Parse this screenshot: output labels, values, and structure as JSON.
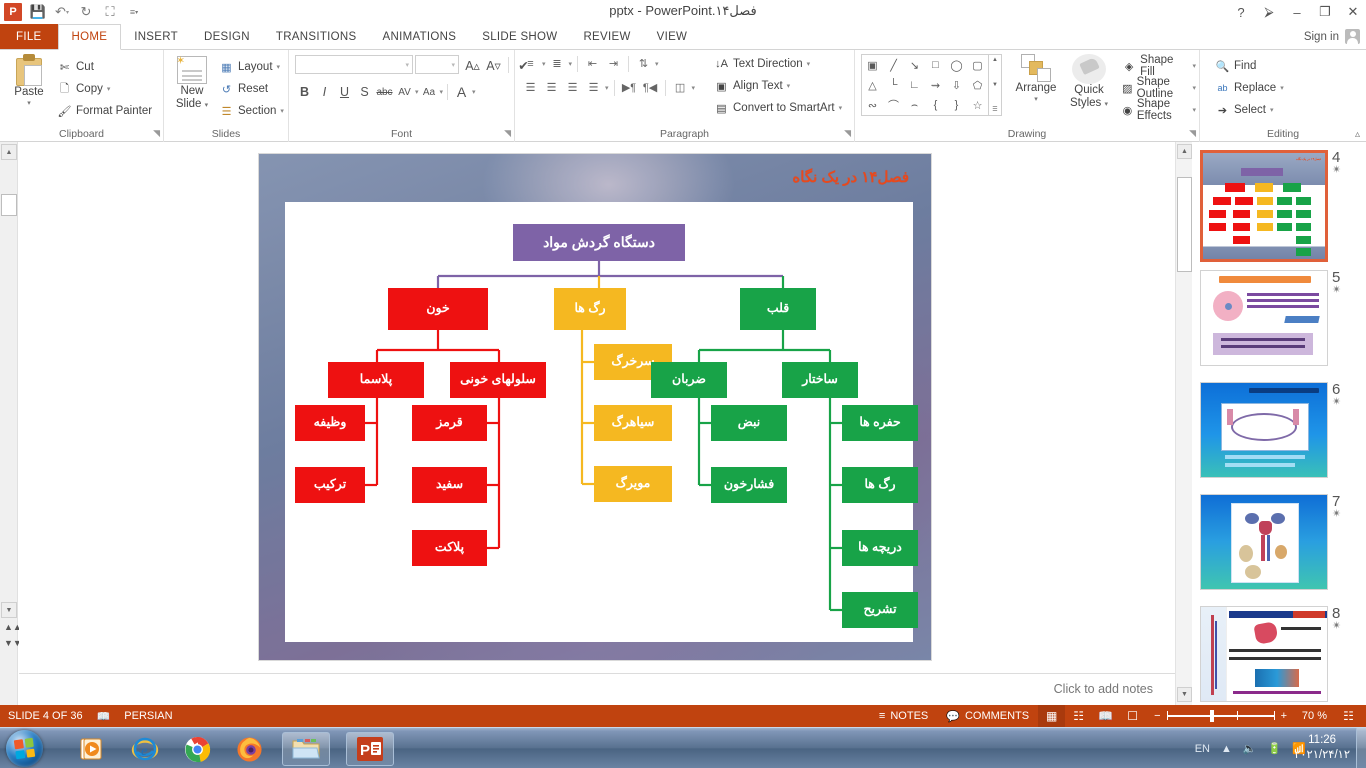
{
  "titlebar": {
    "app_logo": "powerpoint-logo",
    "document_title": "فصل۱۴.pptx - PowerPoint",
    "qat": [
      {
        "name": "save",
        "glyph": "💾"
      },
      {
        "name": "undo",
        "glyph": "↶"
      },
      {
        "name": "redo",
        "glyph": "↻"
      },
      {
        "name": "start-slideshow",
        "glyph": "▣"
      },
      {
        "name": "customize-qat",
        "glyph": "≡"
      }
    ],
    "window_buttons": [
      {
        "name": "help",
        "glyph": "?"
      },
      {
        "name": "ribbon-display-options",
        "glyph": "⬚"
      },
      {
        "name": "minimize",
        "glyph": "–"
      },
      {
        "name": "restore",
        "glyph": "❐"
      },
      {
        "name": "close",
        "glyph": "✕"
      }
    ]
  },
  "tabs": {
    "file": "FILE",
    "items": [
      "HOME",
      "INSERT",
      "DESIGN",
      "TRANSITIONS",
      "ANIMATIONS",
      "SLIDE SHOW",
      "REVIEW",
      "VIEW"
    ],
    "active": "HOME",
    "sign_in": "Sign in"
  },
  "ribbon": {
    "clipboard": {
      "label": "Clipboard",
      "paste": "Paste",
      "cut": "Cut",
      "copy": "Copy",
      "format_painter": "Format Painter"
    },
    "slides": {
      "label": "Slides",
      "new_slide": "New\nSlide",
      "new_slide_line1": "New",
      "new_slide_line2": "Slide",
      "layout": "Layout",
      "reset": "Reset",
      "section": "Section"
    },
    "font": {
      "label": "Font",
      "font_name_value": "",
      "font_size_value": "",
      "buttons": [
        "B",
        "I",
        "U",
        "S",
        "abc",
        "AV",
        "Aa",
        "A"
      ]
    },
    "paragraph": {
      "label": "Paragraph",
      "text_direction": "Text Direction",
      "align_text": "Align Text",
      "convert_to_smartart": "Convert to SmartArt"
    },
    "drawing": {
      "label": "Drawing",
      "arrange": "Arrange",
      "quick_styles_line1": "Quick",
      "quick_styles_line2": "Styles",
      "shape_fill": "Shape Fill",
      "shape_outline": "Shape Outline",
      "shape_effects": "Shape Effects"
    },
    "editing": {
      "label": "Editing",
      "find": "Find",
      "replace": "Replace",
      "select": "Select"
    }
  },
  "slide": {
    "title": "فصل۱۴ در یک نگاه",
    "colors": {
      "root": "#7e63a7",
      "blood": "#ee1111",
      "vessels": "#f5b821",
      "heart": "#18a348",
      "title": "#e8491d"
    },
    "diagram": {
      "root": "دستگاه گردش مواد",
      "branches": [
        {
          "name": "blood",
          "label": "خون",
          "color": "#ee1111",
          "children": [
            {
              "label": "پلاسما",
              "children": [
                {
                  "label": "وظیفه"
                },
                {
                  "label": "ترکیب"
                }
              ]
            },
            {
              "label": "سلولهای خونی",
              "children": [
                {
                  "label": "قرمز"
                },
                {
                  "label": "سفید"
                },
                {
                  "label": "پلاکت"
                }
              ]
            }
          ]
        },
        {
          "name": "vessels",
          "label": "رگ ها",
          "color": "#f5b821",
          "children": [
            {
              "label": "سرخرگ"
            },
            {
              "label": "سیاهرگ"
            },
            {
              "label": "مویرگ"
            }
          ]
        },
        {
          "name": "heart",
          "label": "قلب",
          "color": "#18a348",
          "children": [
            {
              "label": "ضربان",
              "children": [
                {
                  "label": "نبض"
                },
                {
                  "label": "فشارخون"
                }
              ]
            },
            {
              "label": "ساختار",
              "children": [
                {
                  "label": "حفره ها"
                },
                {
                  "label": "رگ ها"
                },
                {
                  "label": "دریچه ها"
                },
                {
                  "label": "تشریح"
                }
              ]
            }
          ]
        }
      ]
    }
  },
  "notes": {
    "placeholder": "Click to add notes"
  },
  "thumbnails": [
    {
      "number": "4",
      "star": "✴",
      "selected": true
    },
    {
      "number": "5",
      "star": "✴",
      "selected": false
    },
    {
      "number": "6",
      "star": "✴",
      "selected": false
    },
    {
      "number": "7",
      "star": "✴",
      "selected": false
    },
    {
      "number": "8",
      "star": "✴",
      "selected": false
    }
  ],
  "status": {
    "slide_counter": "SLIDE 4 OF 36",
    "language": "PERSIAN",
    "notes_button": "NOTES",
    "comments_button": "COMMENTS",
    "zoom_level": "70 %",
    "zoom_out": "−",
    "zoom_in": "+"
  },
  "taskbar": {
    "items": [
      {
        "name": "windows-media-player",
        "boxed": false
      },
      {
        "name": "internet-explorer",
        "boxed": false
      },
      {
        "name": "google-chrome",
        "boxed": false
      },
      {
        "name": "mozilla-firefox",
        "boxed": false
      },
      {
        "name": "file-explorer",
        "boxed": true
      },
      {
        "name": "powerpoint",
        "boxed": true
      }
    ],
    "tray_language": "EN",
    "time": "11:26",
    "date": "۲۰۲۱/۲۴/۱۲"
  }
}
